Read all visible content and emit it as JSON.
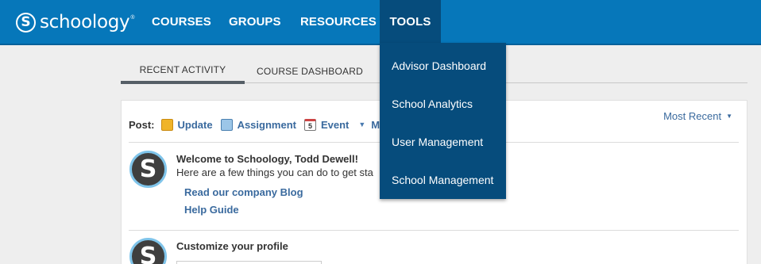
{
  "header": {
    "logo_text": "schoology",
    "logo_mark": "S",
    "logo_tm": "®",
    "nav": [
      "COURSES",
      "GROUPS",
      "RESOURCES",
      "TOOLS"
    ]
  },
  "tools_menu": {
    "items": [
      "Advisor Dashboard",
      "School Analytics",
      "User Management",
      "School Management"
    ]
  },
  "tabs": [
    "RECENT ACTIVITY",
    "COURSE DASHBOARD"
  ],
  "post_bar": {
    "label": "Post:",
    "update": "Update",
    "assignment": "Assignment",
    "event": "Event",
    "more": "Mo",
    "event_icon_day": "5"
  },
  "sort": {
    "label": "Most Recent"
  },
  "feed": {
    "welcome_title": "Welcome to Schoology, Todd Dewell!",
    "welcome_body": "Here are a few things you can do to get sta",
    "link_blog": "Read our company Blog",
    "link_help": "Help Guide",
    "customize_title": "Customize your profile"
  },
  "colors": {
    "header": "#0677ba",
    "tools_active": "#064c7c",
    "link": "#3a6a9e"
  }
}
